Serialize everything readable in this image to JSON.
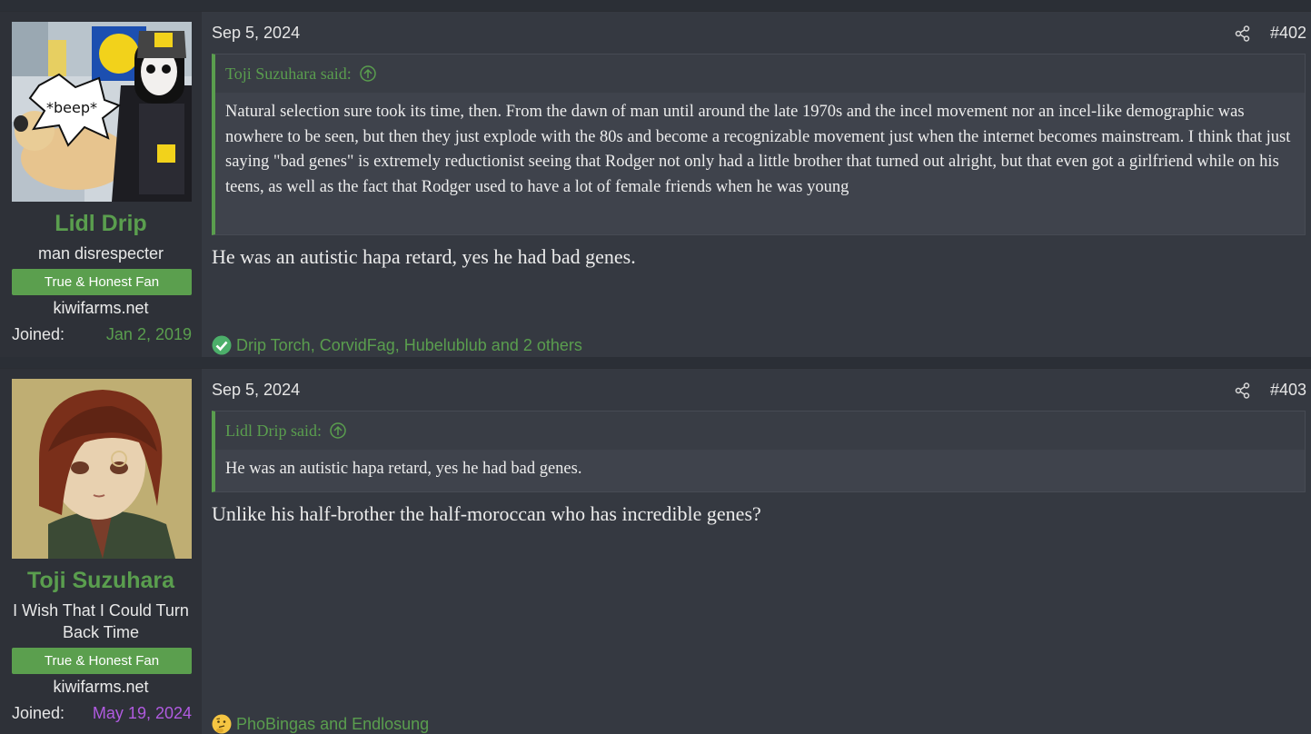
{
  "colors": {
    "accent_green": "#5a9e4e",
    "joined_green": "#5a9e4e",
    "joined_purple": "#b05be0",
    "post_bg": "#353941",
    "sidebar_bg": "#2e3138"
  },
  "posts": [
    {
      "author": "Lidl Drip",
      "user_title": "man disrespecter",
      "banner": "True & Honest Fan",
      "site": "kiwifarms.net",
      "joined_label": "Joined:",
      "joined_date": "Jan 2, 2019",
      "date": "Sep 5, 2024",
      "number": "#402",
      "quote_author": "Toji Suzuhara said:",
      "quote_text": "Natural selection sure took its time, then. From the dawn of man until around the late 1970s and the incel movement nor an incel-like demographic was nowhere to be seen, but then they just explode with the 80s and become a recognizable movement just when the internet becomes mainstream. I think that just saying \"bad genes\" is extremely reductionist seeing that Rodger not only had a little brother that turned out alright, but that even got a girlfriend while on his teens, as well as the fact that Rodger used to have a lot of female friends when he was young",
      "message": "He was an autistic hapa retard, yes he had bad genes.",
      "reactions": "Drip Torch, CorvidFag, Hubelublub and 2 others",
      "reaction_icon": "check-icon",
      "avatar_caption": "*beep*"
    },
    {
      "author": "Toji Suzuhara",
      "user_title": "I Wish That I Could Turn Back Time",
      "banner": "True & Honest Fan",
      "site": "kiwifarms.net",
      "joined_label": "Joined:",
      "joined_date": "May 19, 2024",
      "date": "Sep 5, 2024",
      "number": "#403",
      "quote_author": "Lidl Drip said:",
      "quote_text": "He was an autistic hapa retard, yes he had bad genes.",
      "message": "Unlike his half-brother the half-moroccan who has incredible genes?",
      "reactions": "PhoBingas and Endlosung",
      "reaction_icon": "thinking-face-icon"
    }
  ]
}
